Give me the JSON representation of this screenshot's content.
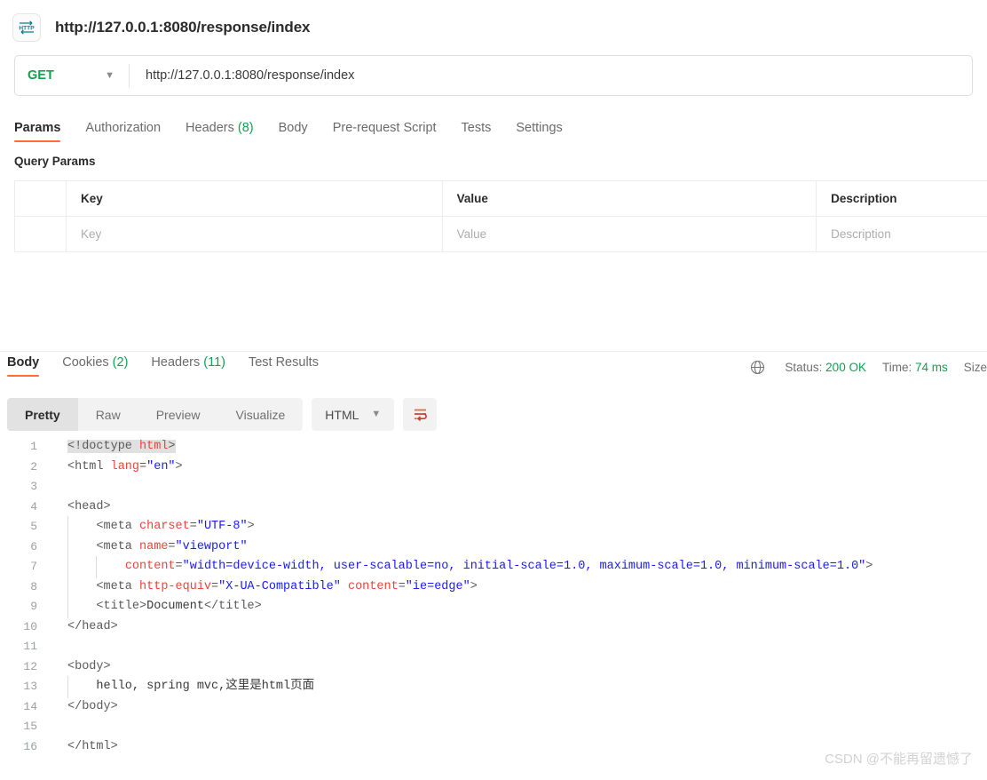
{
  "window": {
    "title": "http://127.0.0.1:8080/response/index",
    "icon": "http-icon"
  },
  "request": {
    "method": "GET",
    "method_caret": "chevron-down-icon",
    "url": "http://127.0.0.1:8080/response/index",
    "tabs": [
      {
        "label": "Params",
        "count": "",
        "active": true
      },
      {
        "label": "Authorization",
        "count": "",
        "active": false
      },
      {
        "label": "Headers",
        "count": "(8)",
        "active": false
      },
      {
        "label": "Body",
        "count": "",
        "active": false
      },
      {
        "label": "Pre-request Script",
        "count": "",
        "active": false
      },
      {
        "label": "Tests",
        "count": "",
        "active": false
      },
      {
        "label": "Settings",
        "count": "",
        "active": false
      }
    ],
    "query_params_title": "Query Params",
    "table": {
      "headers": [
        "Key",
        "Value",
        "Description"
      ],
      "placeholder_row": [
        "Key",
        "Value",
        "Description"
      ]
    }
  },
  "response": {
    "tabs": [
      {
        "label": "Body",
        "count": "",
        "active": true
      },
      {
        "label": "Cookies",
        "count": "(2)",
        "active": false
      },
      {
        "label": "Headers",
        "count": "(11)",
        "active": false
      },
      {
        "label": "Test Results",
        "count": "",
        "active": false
      }
    ],
    "status": {
      "globe_icon": "globe-icon",
      "status_label": "Status:",
      "status_value": "200 OK",
      "time_label": "Time:",
      "time_value": "74 ms",
      "size_label": "Size"
    },
    "view_modes": [
      {
        "label": "Pretty",
        "active": true
      },
      {
        "label": "Raw",
        "active": false
      },
      {
        "label": "Preview",
        "active": false
      },
      {
        "label": "Visualize",
        "active": false
      }
    ],
    "language": "HTML",
    "language_caret": "chevron-down-icon",
    "wrap_button": "word-wrap-icon"
  },
  "code": {
    "lines": [
      {
        "n": "1",
        "segs": [
          {
            "t": "<!doctype ",
            "c": "tg",
            "sel": true
          },
          {
            "t": "html",
            "c": "attr",
            "sel": true
          },
          {
            "t": ">",
            "c": "tg",
            "sel": true
          }
        ],
        "guides": 0
      },
      {
        "n": "2",
        "segs": [
          {
            "t": "<html ",
            "c": "tg"
          },
          {
            "t": "lang",
            "c": "attr"
          },
          {
            "t": "=",
            "c": "tg"
          },
          {
            "t": "\"en\"",
            "c": "str"
          },
          {
            "t": ">",
            "c": "tg"
          }
        ],
        "guides": 0
      },
      {
        "n": "3",
        "segs": [],
        "guides": 0
      },
      {
        "n": "4",
        "segs": [
          {
            "t": "<head>",
            "c": "tg"
          }
        ],
        "guides": 0
      },
      {
        "n": "5",
        "segs": [
          {
            "t": "    <meta ",
            "c": "tg"
          },
          {
            "t": "charset",
            "c": "attr"
          },
          {
            "t": "=",
            "c": "tg"
          },
          {
            "t": "\"UTF-8\"",
            "c": "str"
          },
          {
            "t": ">",
            "c": "tg"
          }
        ],
        "guides": 1
      },
      {
        "n": "6",
        "segs": [
          {
            "t": "    <meta ",
            "c": "tg"
          },
          {
            "t": "name",
            "c": "attr"
          },
          {
            "t": "=",
            "c": "tg"
          },
          {
            "t": "\"viewport\"",
            "c": "str"
          }
        ],
        "guides": 1
      },
      {
        "n": "7",
        "segs": [
          {
            "t": "        ",
            "c": "tg"
          },
          {
            "t": "content",
            "c": "attr"
          },
          {
            "t": "=",
            "c": "tg"
          },
          {
            "t": "\"width=device-width, user-scalable=no, initial-scale=1.0, maximum-scale=1.0, minimum-scale=1.0\"",
            "c": "str"
          },
          {
            "t": ">",
            "c": "tg"
          }
        ],
        "guides": 2
      },
      {
        "n": "8",
        "segs": [
          {
            "t": "    <meta ",
            "c": "tg"
          },
          {
            "t": "http-equiv",
            "c": "attr"
          },
          {
            "t": "=",
            "c": "tg"
          },
          {
            "t": "\"X-UA-Compatible\" ",
            "c": "str"
          },
          {
            "t": "content",
            "c": "attr"
          },
          {
            "t": "=",
            "c": "tg"
          },
          {
            "t": "\"ie=edge\"",
            "c": "str"
          },
          {
            "t": ">",
            "c": "tg"
          }
        ],
        "guides": 1
      },
      {
        "n": "9",
        "segs": [
          {
            "t": "    <title>",
            "c": "tg"
          },
          {
            "t": "Document",
            "c": "txt"
          },
          {
            "t": "</title>",
            "c": "tg"
          }
        ],
        "guides": 1
      },
      {
        "n": "10",
        "segs": [
          {
            "t": "</head>",
            "c": "tg"
          }
        ],
        "guides": 0
      },
      {
        "n": "11",
        "segs": [],
        "guides": 0
      },
      {
        "n": "12",
        "segs": [
          {
            "t": "<body>",
            "c": "tg"
          }
        ],
        "guides": 0
      },
      {
        "n": "13",
        "segs": [
          {
            "t": "    hello, spring mvc,这里是html页面",
            "c": "txt"
          }
        ],
        "guides": 1
      },
      {
        "n": "14",
        "segs": [
          {
            "t": "</body>",
            "c": "tg"
          }
        ],
        "guides": 0
      },
      {
        "n": "15",
        "segs": [],
        "guides": 0
      },
      {
        "n": "16",
        "segs": [
          {
            "t": "</html>",
            "c": "tg"
          }
        ],
        "guides": 0
      }
    ]
  },
  "watermark": "CSDN @不能再留遗憾了",
  "colors": {
    "accent": "#ff6c37",
    "success": "#12a150",
    "attr": "#e8453c",
    "string": "#1a1aff",
    "tag": "#5a5a5a"
  }
}
